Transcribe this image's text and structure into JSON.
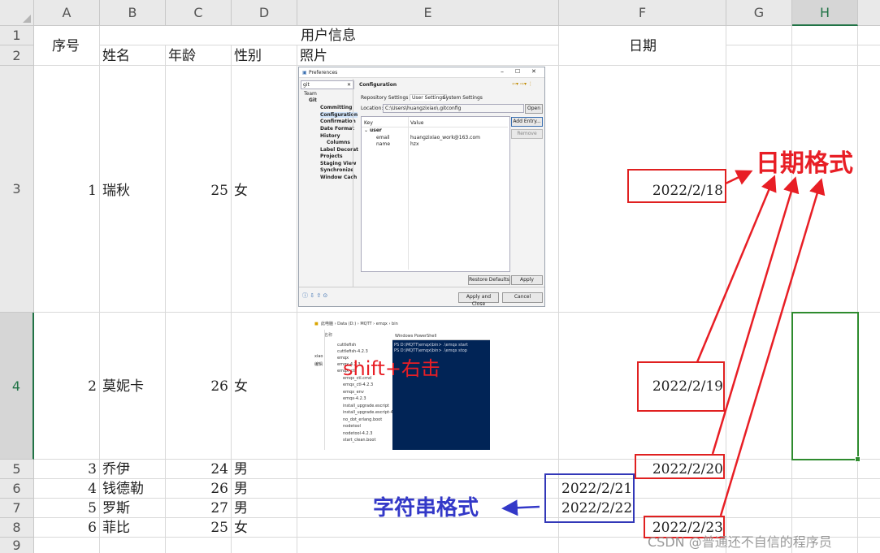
{
  "columns": [
    "A",
    "B",
    "C",
    "D",
    "E",
    "F",
    "G",
    "H"
  ],
  "rows": [
    "1",
    "2",
    "3",
    "4",
    "5",
    "6",
    "7",
    "8",
    "9"
  ],
  "header": {
    "seq": "序号",
    "user_info": "用户信息",
    "date": "日期",
    "name": "姓名",
    "age": "年龄",
    "gender": "性别",
    "photo": "照片"
  },
  "records": [
    {
      "seq": "1",
      "name": "瑞秋",
      "age": "25",
      "gender": "女",
      "date": "2022/2/18"
    },
    {
      "seq": "2",
      "name": "莫妮卡",
      "age": "26",
      "gender": "女",
      "date": "2022/2/19"
    },
    {
      "seq": "3",
      "name": "乔伊",
      "age": "24",
      "gender": "男",
      "date": "2022/2/20"
    },
    {
      "seq": "4",
      "name": "钱德勒",
      "age": "26",
      "gender": "男",
      "date": "2022/2/21"
    },
    {
      "seq": "5",
      "name": "罗斯",
      "age": "27",
      "gender": "男",
      "date": "2022/2/22"
    },
    {
      "seq": "6",
      "name": "菲比",
      "age": "25",
      "gender": "女",
      "date": "2022/2/23"
    }
  ],
  "annotations": {
    "date_format": "日期格式",
    "string_format": "字符串格式",
    "shift_right_click": "shift+右击"
  },
  "watermark": "CSDN @普通还不自信的程序员",
  "preferences_dialog": {
    "title": "Preferences",
    "filter": "git",
    "tree": [
      "Team",
      "Git",
      "Committing",
      "Configuration",
      "Confirmation",
      "Date Format",
      "History",
      "Columns",
      "Label Decorat",
      "Projects",
      "Staging View",
      "Synchronize",
      "Window Cach"
    ],
    "panel_title": "Configuration",
    "tabs": [
      "Repository Settings",
      "User Settings",
      "System Settings"
    ],
    "location_label": "Location:",
    "location_value": "C:\\Users\\huangzixiao\\.gitconfig",
    "open_button": "Open",
    "key_header": "Key",
    "value_header": "Value",
    "section": "user",
    "entries": [
      {
        "key": "email",
        "value": "huangzixiao_work@163.com"
      },
      {
        "key": "name",
        "value": "hzx"
      }
    ],
    "add_entry_button": "Add Entry...",
    "remove_button": "Remove",
    "restore_defaults_button": "Restore Defaults",
    "apply_button": "Apply",
    "apply_close_button": "Apply and Close",
    "cancel_button": "Cancel"
  },
  "explorer_screenshot": {
    "breadcrumb": "此电脑 › Data (D:) › MQTT › emqx › bin",
    "nav_label": "名称",
    "side_items": [
      "xiao",
      "编辑"
    ],
    "files": [
      "cuttlefish",
      "cuttlefish-4.2.3",
      "emqx",
      "emqx-4.2.3",
      "emqx_ctl",
      "emqx_ctl.cmd",
      "emqx_ctl-4.2.3",
      "emqx_env",
      "emqx-4.2.3",
      "install_upgrade.escript",
      "install_upgrade.escript-4.2.3",
      "no_dot_erlang.boot",
      "nodetool",
      "nodetool-4.2.3",
      "start_clean.boot"
    ],
    "terminal_title": "Windows PowerShell",
    "terminal_lines": [
      "PS D:\\MQTT\\emqx\\bin> .\\emqx start",
      "PS D:\\MQTT\\emqx\\bin> .\\emqx stop"
    ]
  },
  "colors": {
    "annotation_red": "#e81e25",
    "annotation_blue": "#3338c8",
    "selection_green": "#2e8b2e",
    "header_bg": "#e9e9e9"
  }
}
